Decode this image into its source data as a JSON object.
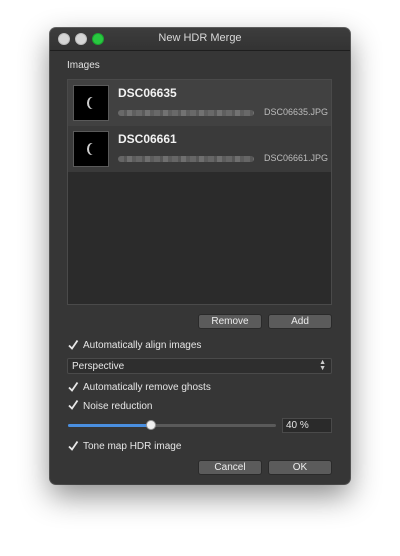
{
  "window": {
    "title": "New HDR Merge"
  },
  "images_section": {
    "label": "Images",
    "items": [
      {
        "name": "DSC06635",
        "path_suffix": "DSC06635.JPG"
      },
      {
        "name": "DSC06661",
        "path_suffix": "DSC06661.JPG"
      }
    ]
  },
  "list_actions": {
    "remove_label": "Remove",
    "add_label": "Add"
  },
  "options": {
    "auto_align": {
      "label": "Automatically align images",
      "checked": true
    },
    "projection": {
      "value": "Perspective"
    },
    "remove_ghosts": {
      "label": "Automatically remove ghosts",
      "checked": true
    },
    "noise_reduction": {
      "label": "Noise reduction",
      "checked": true,
      "value_text": "40 %",
      "level": 0.4
    },
    "tone_map": {
      "label": "Tone map HDR image",
      "checked": true
    }
  },
  "footer": {
    "cancel_label": "Cancel",
    "ok_label": "OK"
  },
  "colors": {
    "window_bg": "#363636",
    "accent": "#4a8fe0",
    "close_button": "#d6d6d6",
    "zoom_button": "#28c840"
  }
}
